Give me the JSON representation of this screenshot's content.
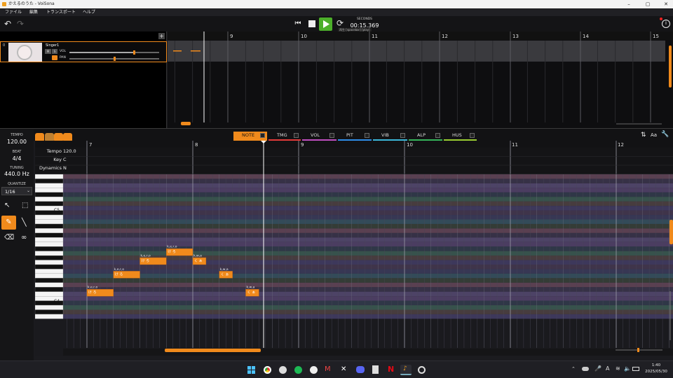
{
  "window": {
    "title": "かえるのうた - VoiSona"
  },
  "menu": {
    "items": [
      "ファイル",
      "編集",
      "トランスポート",
      "ヘルプ"
    ]
  },
  "transport": {
    "time_label": "SECONDS",
    "time_value": "00:15.369",
    "tooltip": "再生 [spacebar] [play]"
  },
  "track": {
    "number": "0",
    "name": "Singer1",
    "vol_label": "VOL",
    "pan_label": "PAN",
    "mute": "M",
    "solo": "S",
    "vol_level": 0.72,
    "pan_level": 0.5
  },
  "arranger": {
    "bar_numbers": [
      "9",
      "10",
      "11",
      "12",
      "13",
      "14",
      "15"
    ]
  },
  "tabs": [
    {
      "label": "NOTE",
      "color": "#f08a1c"
    },
    {
      "label": "TMG",
      "color": "#e33a3a"
    },
    {
      "label": "VOL",
      "color": "#c04ec0"
    },
    {
      "label": "PIT",
      "color": "#2e8ee8"
    },
    {
      "label": "VIB",
      "color": "#3bb7d9"
    },
    {
      "label": "ALP",
      "color": "#35b45a"
    },
    {
      "label": "HUS",
      "color": "#9acd32"
    }
  ],
  "left_panel": {
    "tempo_label": "TEMPO",
    "tempo_value": "120.00",
    "beat_label": "BEAT",
    "beat_value": "4/4",
    "tuning_label": "TUNING",
    "tuning_value": "440.0 Hz",
    "quantize_label": "QUANTIZE",
    "quantize_value": "1/16"
  },
  "pianoroll": {
    "bar_numbers": [
      "7",
      "8",
      "9",
      "10",
      "11",
      "12"
    ],
    "tempo_row_label": "Tempo",
    "tempo_row_value": "120.0",
    "key_row_label": "Key",
    "key_row_value": "C",
    "dynamics_row_label": "Dynamics",
    "dynamics_row_value": "N",
    "c5_label": "C5",
    "c4_label": "C4",
    "notes": [
      {
        "lyric": "け ろ",
        "phoneme": "k,e,r,o",
        "pitch": "C4",
        "start": 7.0,
        "length": 0.25
      },
      {
        "lyric": "け ろ",
        "phoneme": "k,e,r,o",
        "pitch": "E4",
        "start": 7.25,
        "length": 0.25
      },
      {
        "lyric": "け ろ",
        "phoneme": "k,e,r,o",
        "pitch": "G4",
        "start": 7.5,
        "length": 0.25
      },
      {
        "lyric": "け ろ",
        "phoneme": "k,e,r,o",
        "pitch": "A4",
        "start": 7.75,
        "length": 0.25
      },
      {
        "lyric": "く ぁ",
        "phoneme": "k,w,a",
        "pitch": "G4",
        "start": 8.0,
        "length": 0.125
      },
      {
        "lyric": "く ぁ",
        "phoneme": "k,w,a",
        "pitch": "E4",
        "start": 8.25,
        "length": 0.125
      },
      {
        "lyric": "く ぁ",
        "phoneme": "k,w,a",
        "pitch": "C4",
        "start": 8.5,
        "length": 0.125
      }
    ]
  },
  "taskbar": {
    "time": "1:40",
    "date": "2025/05/30"
  }
}
